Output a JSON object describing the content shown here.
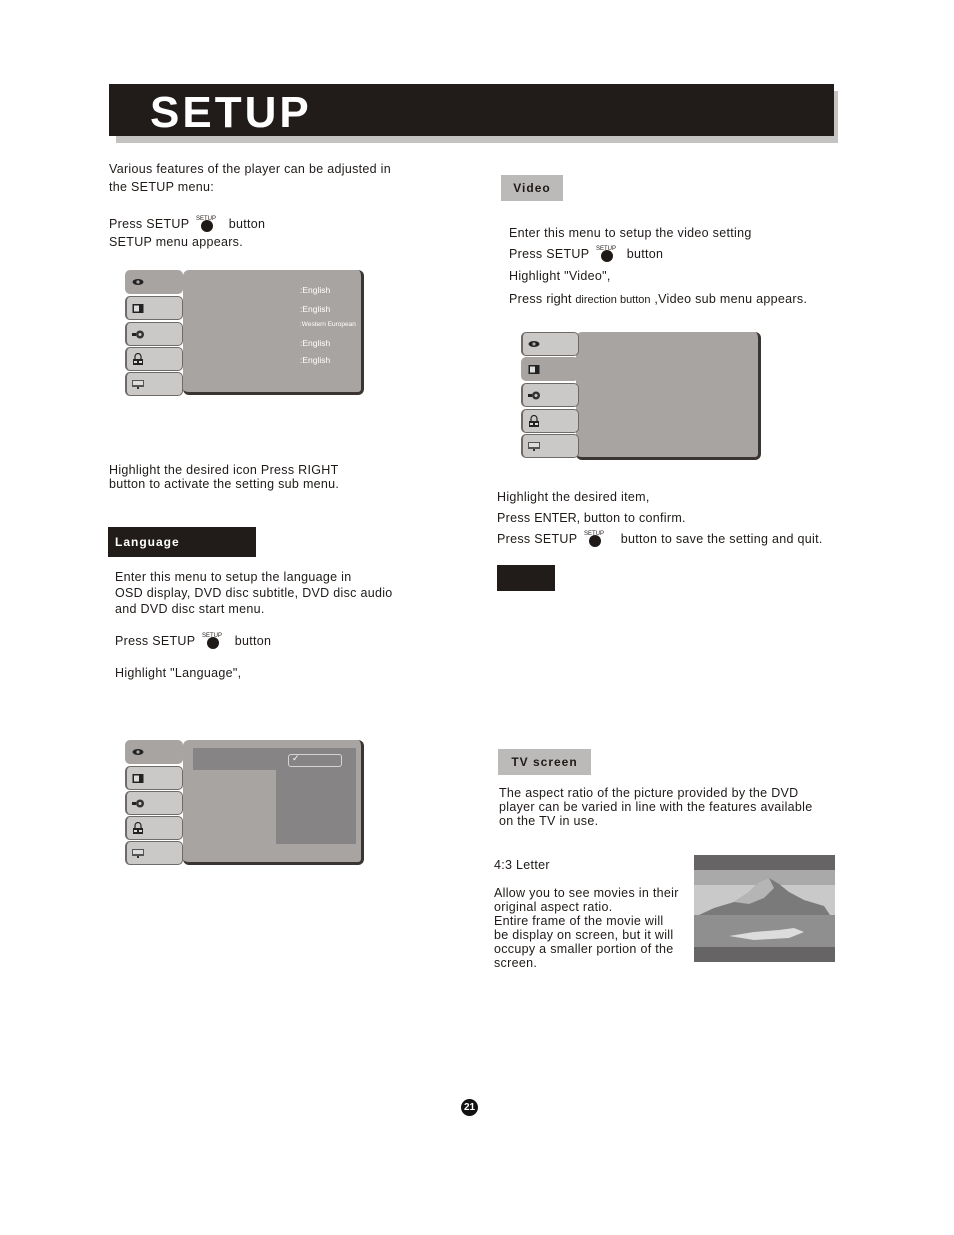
{
  "header": {
    "title": "SETUP"
  },
  "intro": {
    "line1": "Various features of the player can be adjusted in",
    "line2": "the SETUP menu:",
    "press_prefix": "Press SETUP",
    "press_suffix": "button",
    "setup_key_label": "SETUP",
    "appears": "SETUP menu appears."
  },
  "setup_menu": {
    "tabs": [
      {
        "icon": "language-eye-icon",
        "active": true
      },
      {
        "icon": "tv-video-icon",
        "active": false
      },
      {
        "icon": "speaker-audio-icon",
        "active": false
      },
      {
        "icon": "lock-icon",
        "active": false
      },
      {
        "icon": "monitor-misc-icon",
        "active": false
      }
    ],
    "options": [
      ":English",
      ":English",
      ":Western European",
      ":English",
      ":English"
    ]
  },
  "highlight_note": {
    "line1": "Highlight the desired icon Press RIGHT",
    "line2": "button to activate the setting sub menu."
  },
  "language_section": {
    "tag": "Language",
    "line1": "Enter this menu to setup the language in",
    "line2": "OSD display, DVD disc subtitle, DVD disc audio",
    "line3": "and DVD disc start menu.",
    "press_prefix": "Press SETUP",
    "press_suffix": "button",
    "setup_key_label": "SETUP",
    "highlight": "Highlight \"Language\",",
    "check_mark": "✓"
  },
  "video_section": {
    "tag": "Video",
    "line1": "Enter this menu to setup the video setting",
    "press_prefix": "Press SETUP",
    "press_suffix": "button",
    "setup_key_label": "SETUP",
    "highlight": "Highlight \"Video\",",
    "direction_prefix": "Press",
    "direction_word": "right",
    "direction_mid": "direction button",
    "direction_suffix": ",Video sub menu appears."
  },
  "confirm_section": {
    "line1": "Highlight the desired item,",
    "enter_prefix": "Press",
    "enter_word": "ENTER,",
    "enter_suffix": "button to confirm.",
    "press_prefix": "Press SETUP",
    "press_suffix": "button to save the setting and quit.",
    "setup_key_label": "SETUP"
  },
  "tv_screen_section": {
    "tag": "TV screen",
    "line1": "The aspect ratio of the picture provided by the DVD",
    "line2": "player can be varied in line with the features available",
    "line3": "on the TV in use.",
    "mode_title": "4:3 Letter",
    "desc": [
      "Allow you to see movies in their",
      "original aspect ratio.",
      "Entire frame of the movie will",
      "be display on screen, but it will",
      "occupy a smaller portion of the",
      "screen."
    ]
  },
  "page_number": "21"
}
